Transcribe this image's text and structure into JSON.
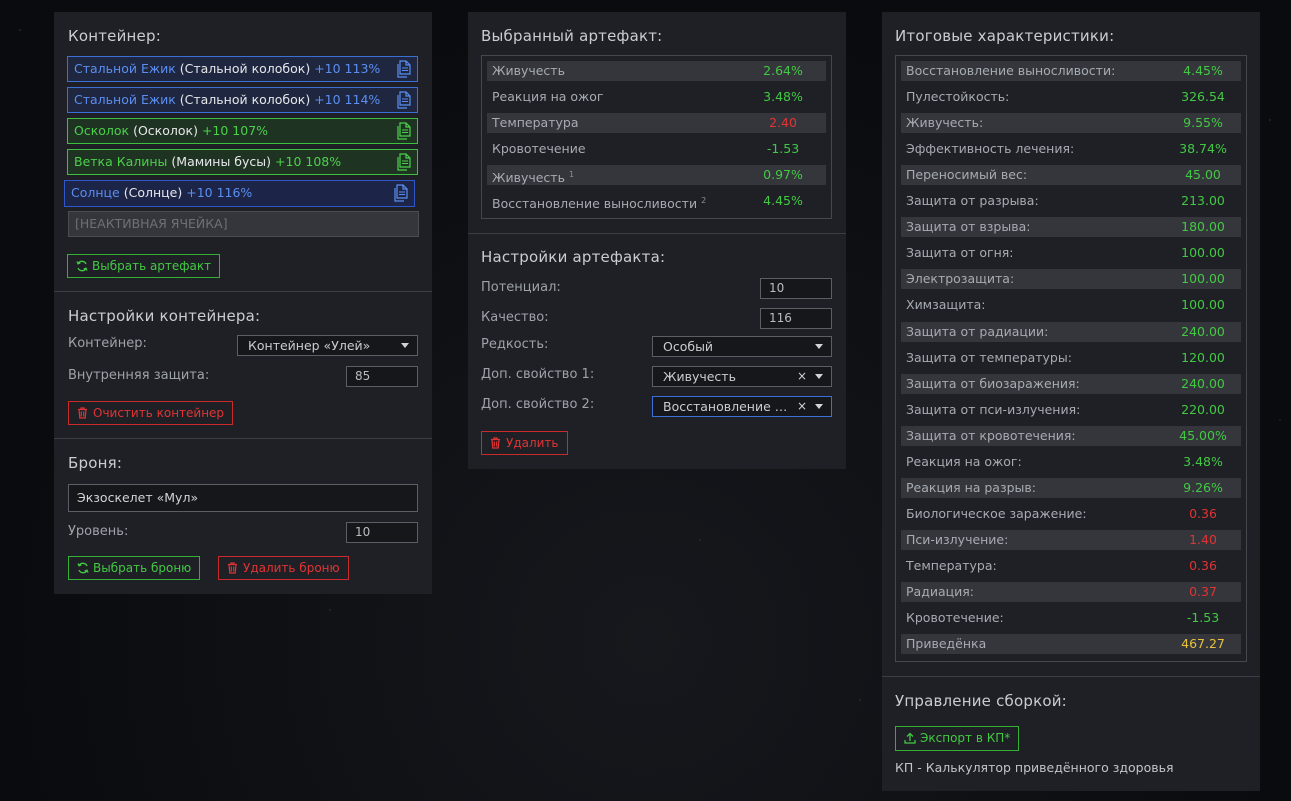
{
  "container_section": {
    "title": "Контейнер:",
    "slots": [
      {
        "name": "Стальной Ежик",
        "base": "(Стальной колобок)",
        "stat": "+10 113%",
        "style": "blue"
      },
      {
        "name": "Стальной Ежик",
        "base": "(Стальной колобок)",
        "stat": "+10 114%",
        "style": "blue"
      },
      {
        "name": "Осколок",
        "base": "(Осколок)",
        "stat": "+10 107%",
        "style": "green"
      },
      {
        "name": "Ветка Калины",
        "base": "(Мамины бусы)",
        "stat": "+10 108%",
        "style": "green"
      },
      {
        "name": "Солнце",
        "base": "(Солнце)",
        "stat": "+10 116%",
        "style": "navy"
      }
    ],
    "inactive_slot": "[НЕАКТИВНАЯ ЯЧЕЙКА]",
    "choose_button": "Выбрать артефакт"
  },
  "container_settings": {
    "title": "Настройки контейнера:",
    "container_label": "Контейнер:",
    "container_value": "Контейнер «Улей»",
    "protection_label": "Внутренняя защита:",
    "protection_value": "85",
    "clear_button": "Очистить контейнер"
  },
  "armor": {
    "title": "Броня:",
    "armor_value": "Экзоскелет «Мул»",
    "level_label": "Уровень:",
    "level_value": "10",
    "choose_button": "Выбрать броню",
    "delete_button": "Удалить броню"
  },
  "selected_artifact": {
    "title": "Выбранный артефакт:",
    "stats": [
      {
        "name": "Живучесть",
        "sup": "",
        "value": "2.64%",
        "color": "green"
      },
      {
        "name": "Реакция на ожог",
        "sup": "",
        "value": "3.48%",
        "color": "green"
      },
      {
        "name": "Температура",
        "sup": "",
        "value": "2.40",
        "color": "red"
      },
      {
        "name": "Кровотечение",
        "sup": "",
        "value": "-1.53",
        "color": "green"
      },
      {
        "name": "Живучесть",
        "sup": "1",
        "value": "0.97%",
        "color": "green"
      },
      {
        "name": "Восстановление выносливости",
        "sup": "2",
        "value": "4.45%",
        "color": "green"
      }
    ]
  },
  "artifact_settings": {
    "title": "Настройки артефакта:",
    "potential_label": "Потенциал:",
    "potential_value": "10",
    "quality_label": "Качество:",
    "quality_value": "116",
    "rarity_label": "Редкость:",
    "rarity_value": "Особый",
    "extra1_label": "Доп. свойство 1:",
    "extra1_value": "Живучесть",
    "extra2_label": "Доп. свойство 2:",
    "extra2_value": "Восстановление выносливости",
    "delete_button": "Удалить"
  },
  "totals": {
    "title": "Итоговые характеристики:",
    "stats": [
      {
        "name": "Восстановление выносливости:",
        "value": "4.45%",
        "color": "green"
      },
      {
        "name": "Пулестойкость:",
        "value": "326.54",
        "color": "green"
      },
      {
        "name": "Живучесть:",
        "value": "9.55%",
        "color": "green"
      },
      {
        "name": "Эффективность лечения:",
        "value": "38.74%",
        "color": "green"
      },
      {
        "name": "Переносимый вес:",
        "value": "45.00",
        "color": "green"
      },
      {
        "name": "Защита от разрыва:",
        "value": "213.00",
        "color": "green"
      },
      {
        "name": "Защита от взрыва:",
        "value": "180.00",
        "color": "green"
      },
      {
        "name": "Защита от огня:",
        "value": "100.00",
        "color": "green"
      },
      {
        "name": "Электрозащита:",
        "value": "100.00",
        "color": "green"
      },
      {
        "name": "Химзащита:",
        "value": "100.00",
        "color": "green"
      },
      {
        "name": "Защита от радиации:",
        "value": "240.00",
        "color": "green"
      },
      {
        "name": "Защита от температуры:",
        "value": "120.00",
        "color": "green"
      },
      {
        "name": "Защита от биозаражения:",
        "value": "240.00",
        "color": "green"
      },
      {
        "name": "Защита от пси-излучения:",
        "value": "220.00",
        "color": "green"
      },
      {
        "name": "Защита от кровотечения:",
        "value": "45.00%",
        "color": "green"
      },
      {
        "name": "Реакция на ожог:",
        "value": "3.48%",
        "color": "green"
      },
      {
        "name": "Реакция на разрыв:",
        "value": "9.26%",
        "color": "green"
      },
      {
        "name": "Биологическое заражение:",
        "value": "0.36",
        "color": "red"
      },
      {
        "name": "Пси-излучение:",
        "value": "1.40",
        "color": "red"
      },
      {
        "name": "Температура:",
        "value": "0.36",
        "color": "red"
      },
      {
        "name": "Радиация:",
        "value": "0.37",
        "color": "red"
      },
      {
        "name": "Кровотечение:",
        "value": "-1.53",
        "color": "green"
      },
      {
        "name": "Приведёнка",
        "value": "467.27",
        "color": "yellow"
      }
    ]
  },
  "build_management": {
    "title": "Управление сборкой:",
    "export_button": "Экспорт в КП*",
    "footnote": "КП - Калькулятор приведённого здоровья"
  },
  "colors": {
    "green": "#43c843",
    "red": "#e03434",
    "yellow": "#e8c23c",
    "blue": "#5b8ef0"
  }
}
